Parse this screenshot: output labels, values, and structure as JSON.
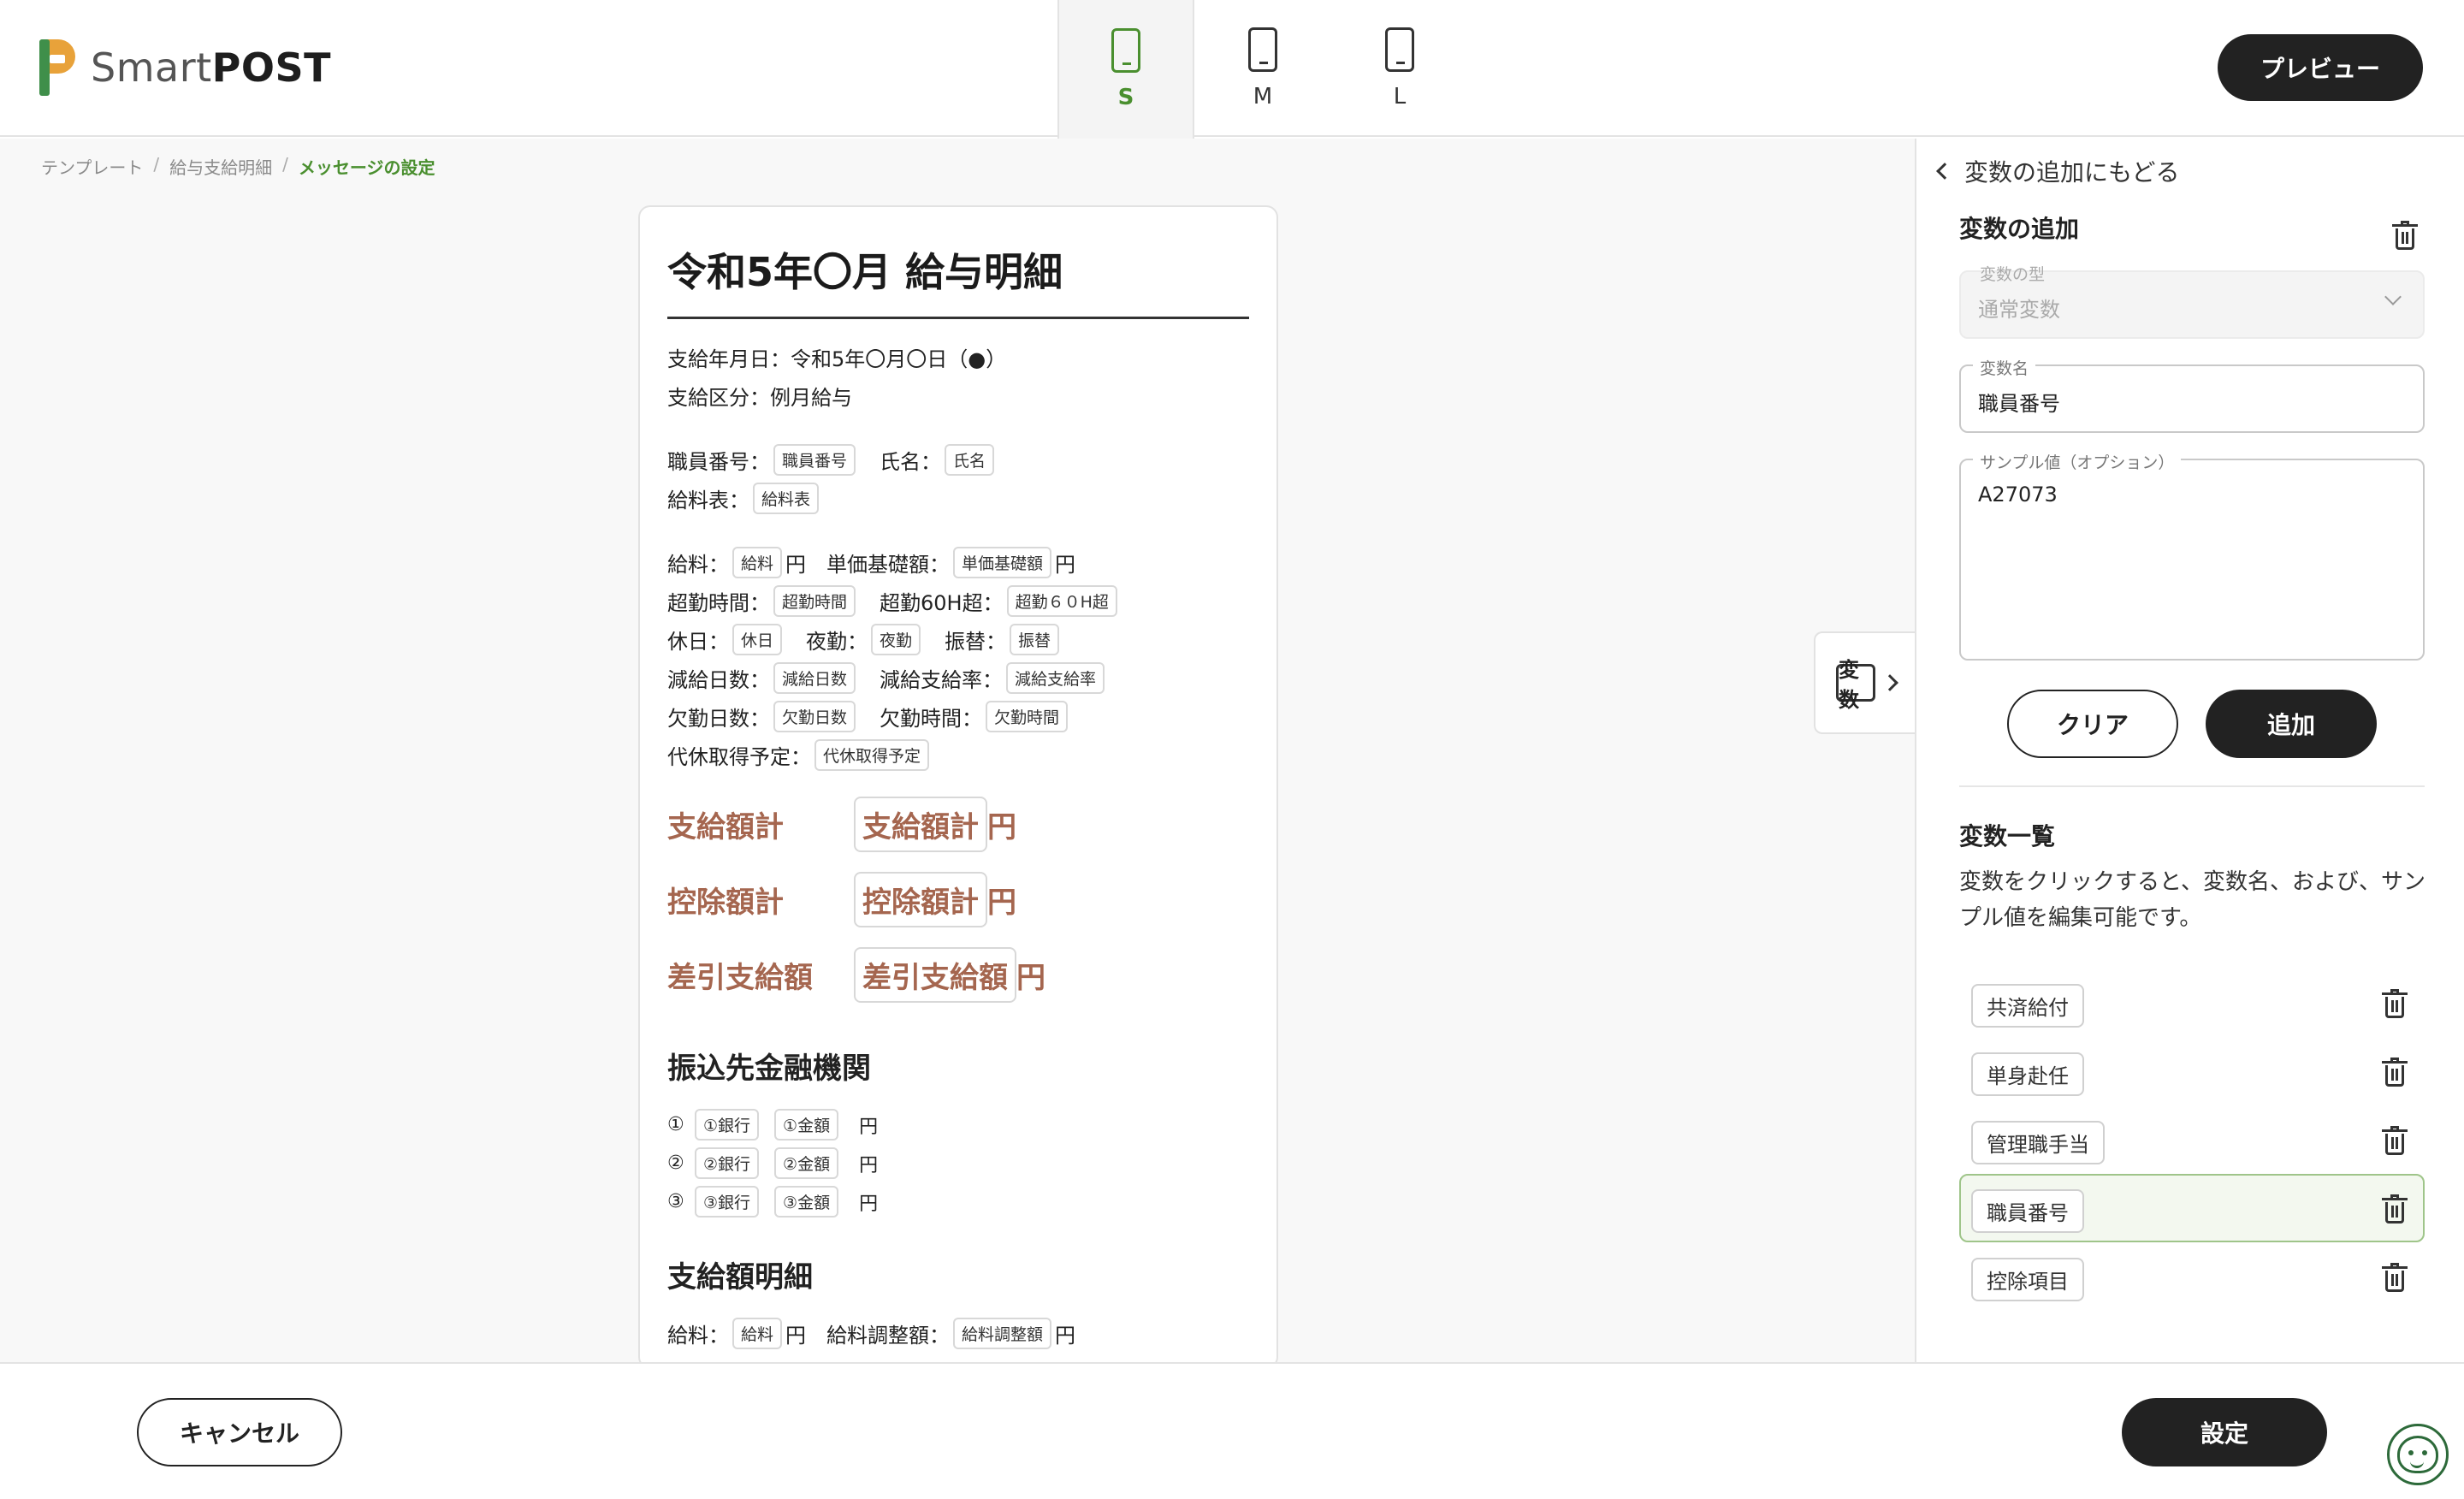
{
  "header": {
    "logo_light": "Smart",
    "logo_bold": "POST",
    "device_tabs": [
      {
        "label": "S",
        "active": true
      },
      {
        "label": "M",
        "active": false
      },
      {
        "label": "L",
        "active": false
      }
    ],
    "preview_label": "プレビュー"
  },
  "breadcrumb": {
    "items": [
      "テンプレート",
      "給与支給明細",
      "メッセージの設定"
    ],
    "separator": "/"
  },
  "document": {
    "title": "令和5年〇月 給与明細",
    "pay_date": "支給年月日：令和5年〇月〇日（●）",
    "pay_type": "支給区分：例月給与",
    "fields": {
      "employee_no_label": "職員番号：",
      "employee_no_var": "職員番号",
      "name_label": "氏名：",
      "name_var": "氏名",
      "salary_table_label": "給料表：",
      "salary_table_var": "給料表",
      "salary_label": "給料：",
      "salary_var": "給料",
      "unit_base_label": "単価基礎額：",
      "unit_base_var": "単価基礎額",
      "overtime_label": "超勤時間：",
      "overtime_var": "超勤時間",
      "overtime60_label": "超勤60H超：",
      "overtime60_var": "超勤６０H超",
      "holiday_label": "休日：",
      "holiday_var": "休日",
      "night_label": "夜勤：",
      "night_var": "夜勤",
      "transfer_label": "振替：",
      "transfer_var": "振替",
      "reduce_days_label": "減給日数：",
      "reduce_days_var": "減給日数",
      "reduce_rate_label": "減給支給率：",
      "reduce_rate_var": "減給支給率",
      "absence_days_label": "欠勤日数：",
      "absence_days_var": "欠勤日数",
      "absence_hours_label": "欠勤時間：",
      "absence_hours_var": "欠勤時間",
      "comp_leave_label": "代休取得予定：",
      "comp_leave_var": "代休取得予定",
      "yen": "円"
    },
    "sums": [
      {
        "label": "支給額計",
        "var": "支給額計"
      },
      {
        "label": "控除額計",
        "var": "控除額計"
      },
      {
        "label": "差引支給額",
        "var": "差引支給額"
      }
    ],
    "bank_section_title": "振込先金融機関",
    "banks": [
      {
        "num": "①",
        "bank": "①銀行",
        "amount": "①金額"
      },
      {
        "num": "②",
        "bank": "②銀行",
        "amount": "②金額"
      },
      {
        "num": "③",
        "bank": "③銀行",
        "amount": "③金額"
      }
    ],
    "detail_section_title": "支給額明細",
    "detail": {
      "salary_label": "給料：",
      "salary_var": "給料",
      "adjust_label": "給料調整額：",
      "adjust_var": "給料調整額"
    }
  },
  "var_toggle": {
    "icon_text": "変数"
  },
  "panel": {
    "back_label": "変数の追加にもどる",
    "title": "変数の追加",
    "type_field": {
      "label": "変数の型",
      "value": "通常変数"
    },
    "name_field": {
      "label": "変数名",
      "value": "職員番号"
    },
    "sample_field": {
      "label": "サンプル値（オプション）",
      "value": "A27073"
    },
    "clear_label": "クリア",
    "add_label": "追加",
    "list_title": "変数一覧",
    "list_desc": "変数をクリックすると、変数名、および、サンプル値を編集可能です。",
    "variables": [
      {
        "name": "共済給付",
        "selected": false
      },
      {
        "name": "単身赴任",
        "selected": false
      },
      {
        "name": "管理職手当",
        "selected": false
      },
      {
        "name": "職員番号",
        "selected": true
      },
      {
        "name": "控除項目",
        "selected": false
      }
    ]
  },
  "footer": {
    "cancel_label": "キャンセル",
    "set_label": "設定"
  },
  "colors": {
    "accent_green": "#4a8f2f",
    "sum_brown": "#a5664f",
    "button_dark": "#222222"
  },
  "icons": [
    "phone-icon",
    "chevron-left-icon",
    "chevron-right-icon",
    "chevron-down-icon",
    "trash-icon",
    "variable-icon",
    "support-chat-icon"
  ]
}
